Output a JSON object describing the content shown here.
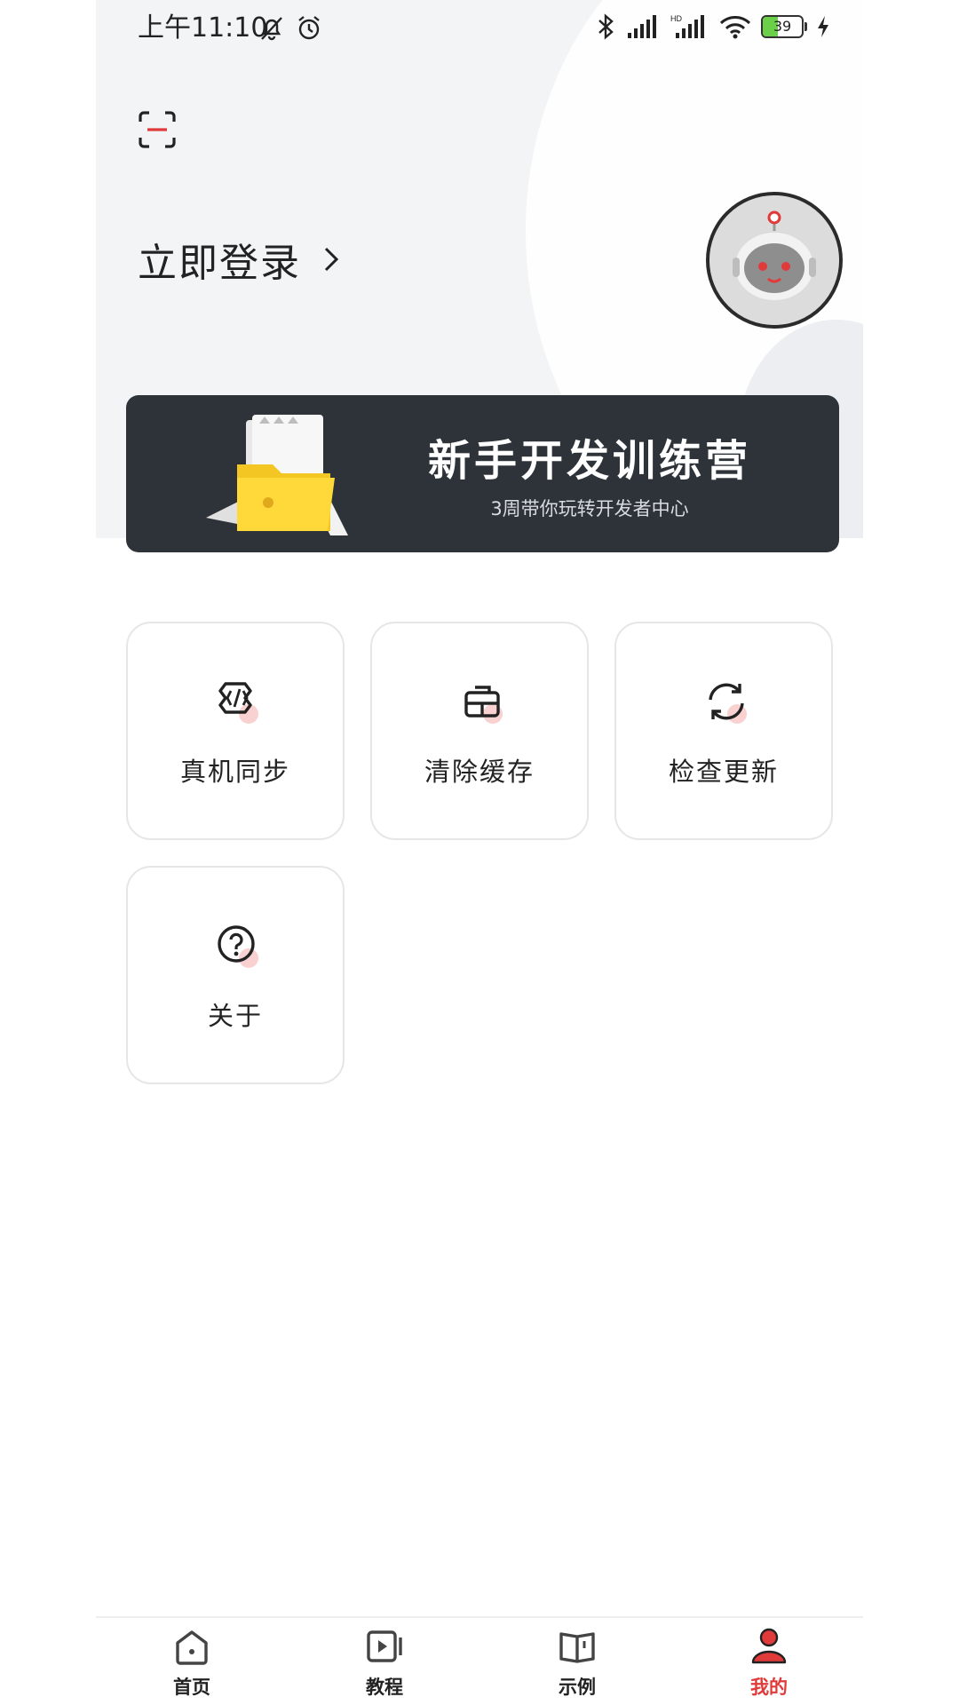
{
  "status_bar": {
    "time": "上午11:10",
    "battery": "39",
    "battery_level": 0.39
  },
  "login": {
    "label": "立即登录"
  },
  "banner": {
    "title": "新手开发训练营",
    "subtitle": "3周带你玩转开发者中心"
  },
  "actions": [
    {
      "label": "真机同步",
      "icon": "code-sync-icon"
    },
    {
      "label": "清除缓存",
      "icon": "clear-cache-icon"
    },
    {
      "label": "检查更新",
      "icon": "refresh-icon"
    },
    {
      "label": "关于",
      "icon": "question-icon"
    }
  ],
  "tabs": [
    {
      "label": "首页",
      "icon": "home-icon",
      "active": false
    },
    {
      "label": "教程",
      "icon": "video-icon",
      "active": false
    },
    {
      "label": "示例",
      "icon": "book-icon",
      "active": false
    },
    {
      "label": "我的",
      "icon": "user-icon",
      "active": true
    }
  ],
  "colors": {
    "accent": "#e03a3a",
    "header_bg": "#f3f4f6",
    "banner_bg": "#2e333a"
  }
}
